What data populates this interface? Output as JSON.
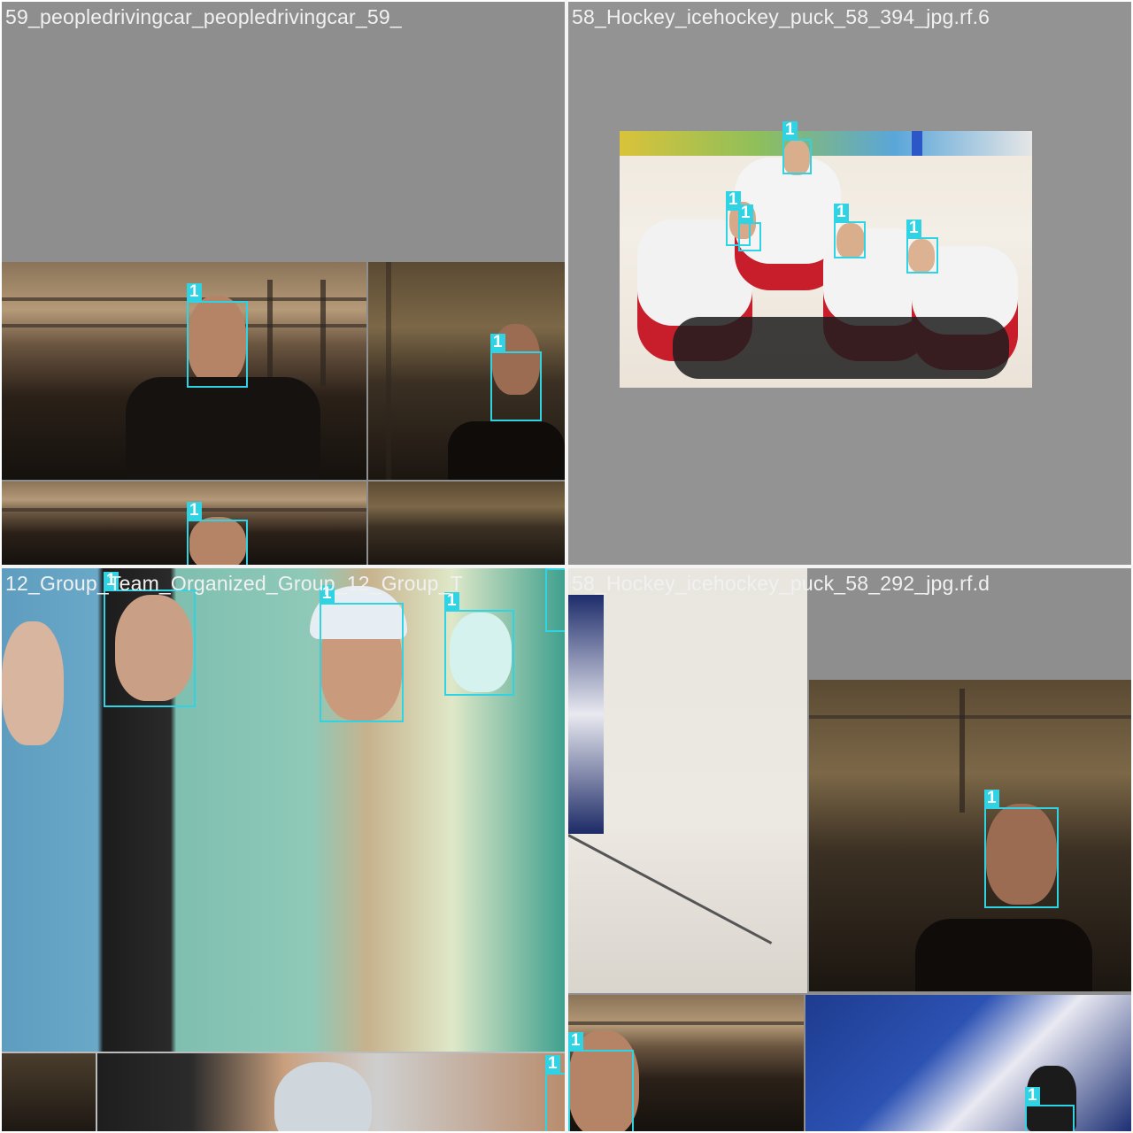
{
  "tiles": [
    {
      "label": "59_peopledrivingcar_peopledrivingcar_59_"
    },
    {
      "label": "58_Hockey_icehockey_puck_58_394_jpg.rf.6"
    },
    {
      "label": "12_Group_Team_Organized_Group_12_Group_T"
    },
    {
      "label": "58_Hockey_icehockey_puck_58_292_jpg.rf.d"
    }
  ],
  "box_class_label": "1",
  "colors": {
    "box": "#2fd3e3",
    "padding_gray": "#8e8e8e",
    "label_text": "#f1f1f1"
  }
}
